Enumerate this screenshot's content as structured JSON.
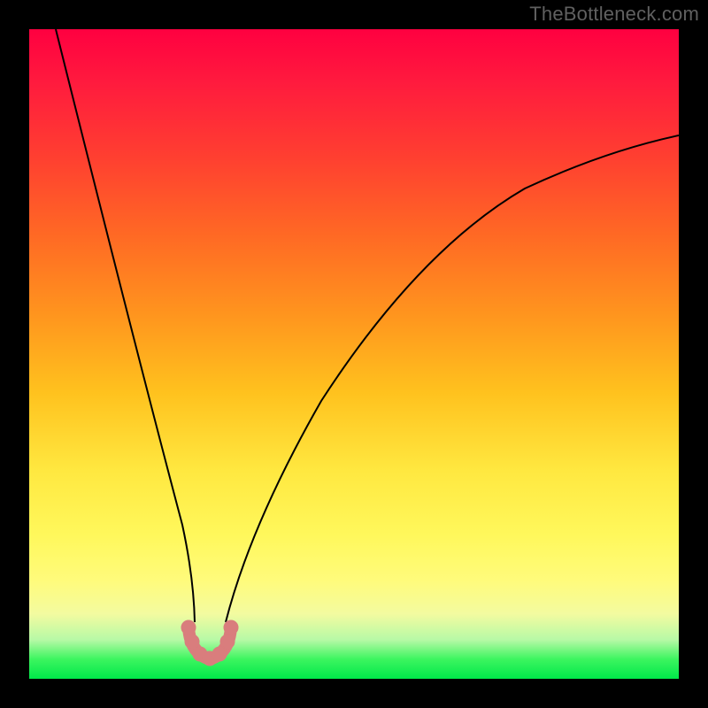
{
  "watermark": "TheBottleneck.com",
  "chart_data": {
    "type": "line",
    "title": "",
    "xlabel": "",
    "ylabel": "",
    "xlim": [
      0,
      100
    ],
    "ylim": [
      0,
      100
    ],
    "background_gradient": {
      "direction": "vertical",
      "stops": [
        {
          "pos": 0,
          "color": "#ff0040"
        },
        {
          "pos": 20,
          "color": "#ff4030"
        },
        {
          "pos": 44,
          "color": "#ff951e"
        },
        {
          "pos": 68,
          "color": "#ffe840"
        },
        {
          "pos": 85,
          "color": "#fffb7c"
        },
        {
          "pos": 94,
          "color": "#b7f9a6"
        },
        {
          "pos": 100,
          "color": "#00e84a"
        }
      ]
    },
    "series": [
      {
        "name": "left-branch",
        "style": "thin-black-line",
        "x": [
          4,
          7,
          10,
          13,
          16,
          19,
          22,
          23.5,
          25
        ],
        "y": [
          100,
          84,
          68,
          53,
          39,
          26,
          13,
          7,
          3
        ]
      },
      {
        "name": "right-branch",
        "style": "thin-black-line",
        "x": [
          30,
          32,
          36,
          42,
          50,
          60,
          72,
          86,
          100
        ],
        "y": [
          3,
          8,
          18,
          31,
          44,
          56,
          66,
          74,
          80
        ]
      },
      {
        "name": "valley-highlight",
        "style": "salmon-thick-dots",
        "x": [
          24.3,
          25.2,
          26.0,
          27.0,
          28.0,
          29.0,
          29.8,
          30.6
        ],
        "y": [
          5.5,
          3.8,
          2.8,
          2.3,
          2.3,
          2.8,
          3.8,
          5.5
        ]
      }
    ]
  }
}
